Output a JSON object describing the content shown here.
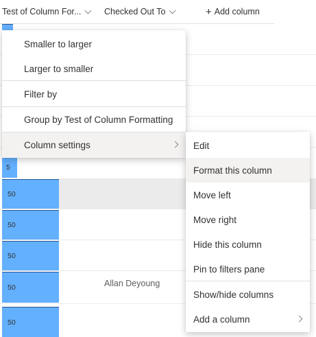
{
  "header": {
    "col1_label": "Test of Column For...",
    "col2_label": "Checked Out To",
    "add_label": "Add column",
    "add_icon": "+"
  },
  "grid": {
    "bar_labels": [
      "5",
      "50",
      "50",
      "50",
      "50",
      "50"
    ],
    "checked_out_value": "Allan Deyoung"
  },
  "column_menu": {
    "items": [
      "Smaller to larger",
      "Larger to smaller",
      "Filter by",
      "Group by Test of Column Formatting",
      "Column settings"
    ]
  },
  "settings_submenu": {
    "items": [
      "Edit",
      "Format this column",
      "Move left",
      "Move right",
      "Hide this column",
      "Pin to filters pane",
      "Show/hide columns",
      "Add a column"
    ]
  },
  "colors": {
    "bar_fill": "#63b0ff",
    "bar_border": "#2b5797",
    "hover": "#f3f2f1",
    "selected_row": "#ebebeb"
  }
}
